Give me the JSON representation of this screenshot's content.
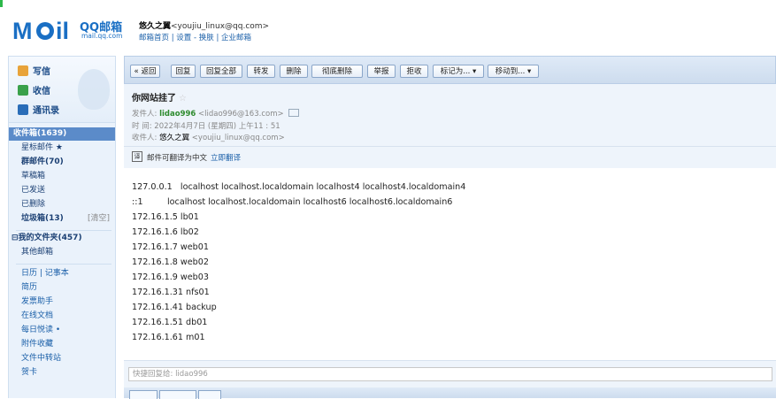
{
  "header": {
    "logo_mail": "M",
    "logo_il": "il",
    "logo_qq": "QQ邮箱",
    "logo_domain": "mail.qq.com",
    "user_name": "悠久之翼",
    "user_email": "<youjiu_linux@qq.com>",
    "links": "邮箱首页 | 设置 - 换肤 | 企业邮箱"
  },
  "sidebar": {
    "compose": "写信",
    "inbox_check": "收信",
    "contacts": "通讯录",
    "folders": [
      {
        "label": "收件箱(1639)",
        "selected": true
      },
      {
        "label": "星标邮件 ★"
      },
      {
        "label": "群邮件(70)",
        "bold": true
      },
      {
        "label": "草稿箱"
      },
      {
        "label": "已发送"
      },
      {
        "label": "已删除"
      },
      {
        "label": "垃圾箱(13)",
        "bold": true,
        "extra": "[清空]"
      }
    ],
    "my_folders": "⊟我的文件夹(457)",
    "other_mail": "其他邮箱",
    "apps_top": "日历 | 记事本",
    "apps": [
      "简历",
      "发票助手",
      "在线文档",
      "每日悦读 •",
      "附件收藏",
      "文件中转站",
      "贺卡"
    ]
  },
  "toolbar": {
    "buttons": [
      "« 返回",
      "回复",
      "回复全部",
      "转发",
      "删除",
      "彻底删除",
      "举报",
      "拒收",
      "标记为... ▾",
      "移动到... ▾"
    ]
  },
  "message": {
    "subject": "你网站挂了",
    "star": "☆",
    "from_label": "发件人:",
    "from_name": "lidao996",
    "from_email": "<lidao996@163.com>",
    "time_label": "时  间:",
    "time_value": "2022年4月7日 (星期四) 上午11 : 51",
    "to_label": "收件人:",
    "to_name": "悠久之翼",
    "to_email": "<youjiu_linux@qq.com>",
    "translate_text": "邮件可翻译为中文",
    "translate_link": "立即翻译",
    "lines": [
      "127.0.0.1   localhost localhost.localdomain localhost4 localhost4.localdomain4",
      "::1         localhost localhost.localdomain localhost6 localhost6.localdomain6",
      "172.16.1.5 lb01",
      "172.16.1.6 lb02",
      "172.16.1.7 web01",
      "172.16.1.8 web02",
      "172.16.1.9 web03",
      "172.16.1.31 nfs01",
      "172.16.1.41 backup",
      "172.16.1.51 db01",
      "172.16.1.61 m01"
    ]
  },
  "reply": {
    "placeholder": "快捷回复给: lidao996"
  }
}
